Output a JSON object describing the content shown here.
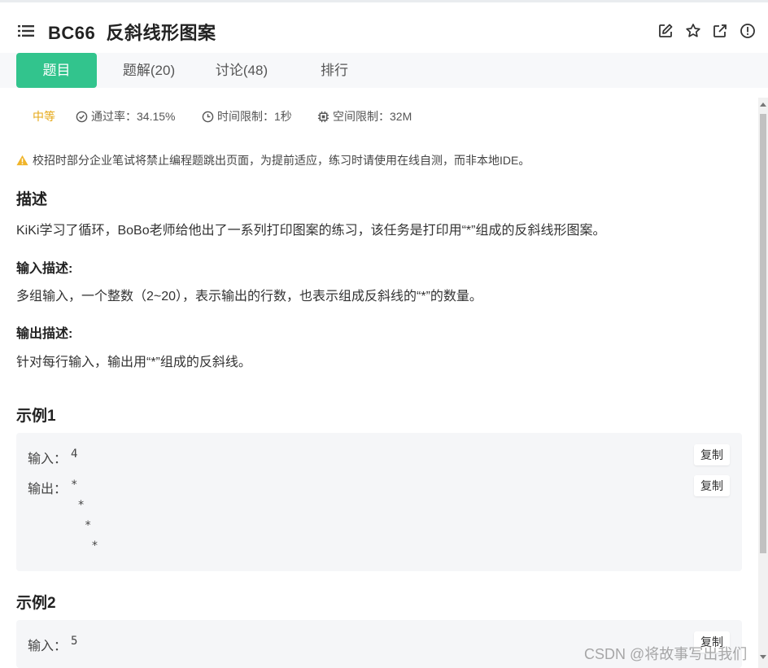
{
  "header": {
    "title": "BC66  反斜线形图案",
    "icons": [
      "list-icon",
      "edit-icon",
      "star-icon",
      "external-link-icon",
      "info-icon"
    ]
  },
  "tabs": [
    {
      "label": "题目",
      "active": true
    },
    {
      "label": "题解(20)",
      "active": false
    },
    {
      "label": "讨论(48)",
      "active": false
    },
    {
      "label": "排行",
      "active": false
    }
  ],
  "meta": {
    "difficulty": "中等",
    "pass_rate": "通过率：34.15%",
    "time_limit": "时间限制：1秒",
    "space_limit": "空间限制：32M"
  },
  "notice": "校招时部分企业笔试将禁止编程题跳出页面，为提前适应，练习时请使用在线自测，而非本地IDE。",
  "description": {
    "heading": "描述",
    "text": "KiKi学习了循环，BoBo老师给他出了一系列打印图案的练习，该任务是打印用“*”组成的反斜线形图案。"
  },
  "input_desc": {
    "heading": "输入描述:",
    "text": "多组输入，一个整数（2~20），表示输出的行数，也表示组成反斜线的“*”的数量。"
  },
  "output_desc": {
    "heading": "输出描述:",
    "text": "针对每行输入，输出用“*”组成的反斜线。"
  },
  "examples": [
    {
      "heading": "示例1",
      "input_label": "输入：",
      "input_value": "4",
      "output_label": "输出：",
      "output_value": "*\n *\n  *\n   *",
      "copy_label": "复制"
    },
    {
      "heading": "示例2",
      "input_label": "输入：",
      "input_value": "5",
      "copy_label": "复制"
    }
  ],
  "watermark": "CSDN @将故事写出我们",
  "colors": {
    "accent": "#32c48d",
    "difficulty": "#e6a817",
    "warning": "#f0b429"
  }
}
